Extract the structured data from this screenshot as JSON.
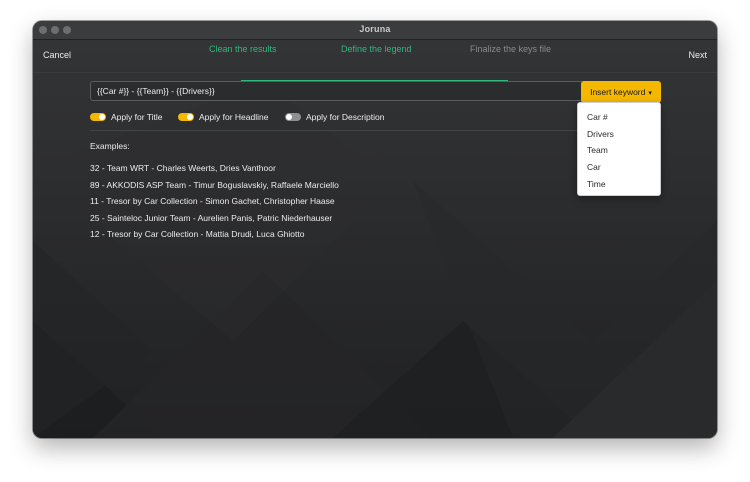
{
  "window": {
    "title": "Joruna"
  },
  "navbar": {
    "cancel_label": "Cancel",
    "next_label": "Next",
    "steps": [
      {
        "label": "Clean the results",
        "state": "done"
      },
      {
        "label": "Define the legend",
        "state": "done"
      },
      {
        "label": "Finalize the keys file",
        "state": "pending"
      }
    ]
  },
  "editor": {
    "formula": "{{Car #}} - {{Team}} - {{Drivers}}",
    "insert_label": "Insert keyword"
  },
  "toggles": [
    {
      "label": "Apply for Title",
      "on": true
    },
    {
      "label": "Apply for Headline",
      "on": true
    },
    {
      "label": "Apply for Description",
      "on": false
    }
  ],
  "examples": {
    "title": "Examples:",
    "items": [
      "32 - Team WRT - Charles Weerts, Dries Vanthoor",
      "89 - AKKODIS ASP Team - Timur Boguslavskiy, Raffaele Marciello",
      "11 - Tresor by Car Collection - Simon Gachet, Christopher Haase",
      "25 - Sainteloc Junior Team - Aurelien Panis, Patric Niederhauser",
      "12 - Tresor by Car Collection - Mattia Drudi, Luca Ghiotto"
    ]
  },
  "keyword_menu": [
    "Car #",
    "Drivers",
    "Team",
    "Car",
    "Time"
  ],
  "colors": {
    "accent_yellow": "#f5b800",
    "step_done_green": "#2eb87a",
    "step_pending_gray": "#8a8b8d",
    "background": "#2a2b2d"
  },
  "icons": {
    "insert_caret": "caret-down-icon"
  }
}
